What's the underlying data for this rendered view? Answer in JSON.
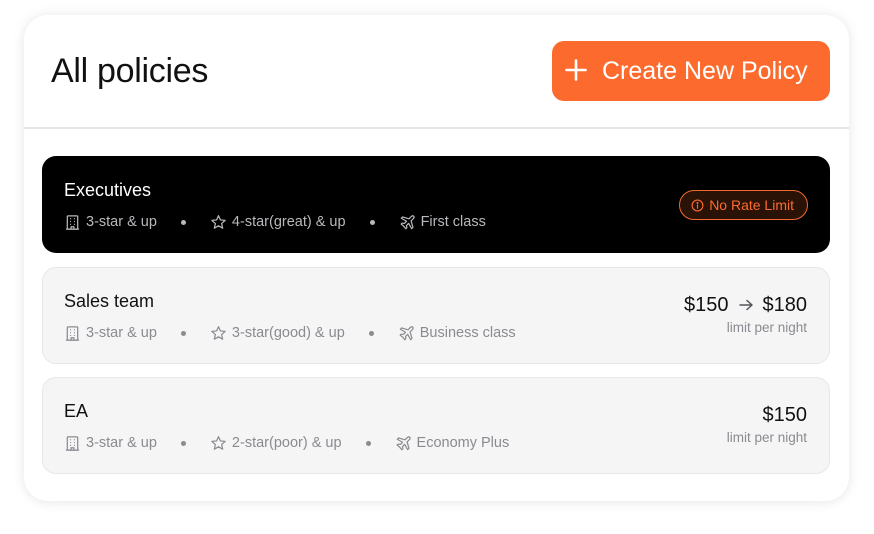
{
  "header": {
    "title": "All policies",
    "create_button_label": "Create New Policy"
  },
  "colors": {
    "accent": "#fc6b2d",
    "selected_card_bg": "#000000",
    "card_bg": "#f5f5f6"
  },
  "policies": [
    {
      "name": "Executives",
      "selected": true,
      "hotel": "3-star & up",
      "rating": "4-star(great) & up",
      "flight": "First class",
      "badge": "No Rate Limit"
    },
    {
      "name": "Sales team",
      "selected": false,
      "hotel": "3-star & up",
      "rating": "3-star(good) & up",
      "flight": "Business class",
      "rate_from": "$150",
      "rate_to": "$180",
      "rate_sub": "limit per night"
    },
    {
      "name": "EA",
      "selected": false,
      "hotel": "3-star & up",
      "rating": "2-star(poor) & up",
      "flight": "Economy Plus",
      "rate_from": "$150",
      "rate_sub": "limit per night"
    }
  ],
  "icons": {
    "hotel": "building-icon",
    "rating": "star-icon",
    "flight": "plane-icon",
    "badge": "info-icon",
    "create": "plus-icon",
    "rate_range": "arrow-right-icon"
  }
}
